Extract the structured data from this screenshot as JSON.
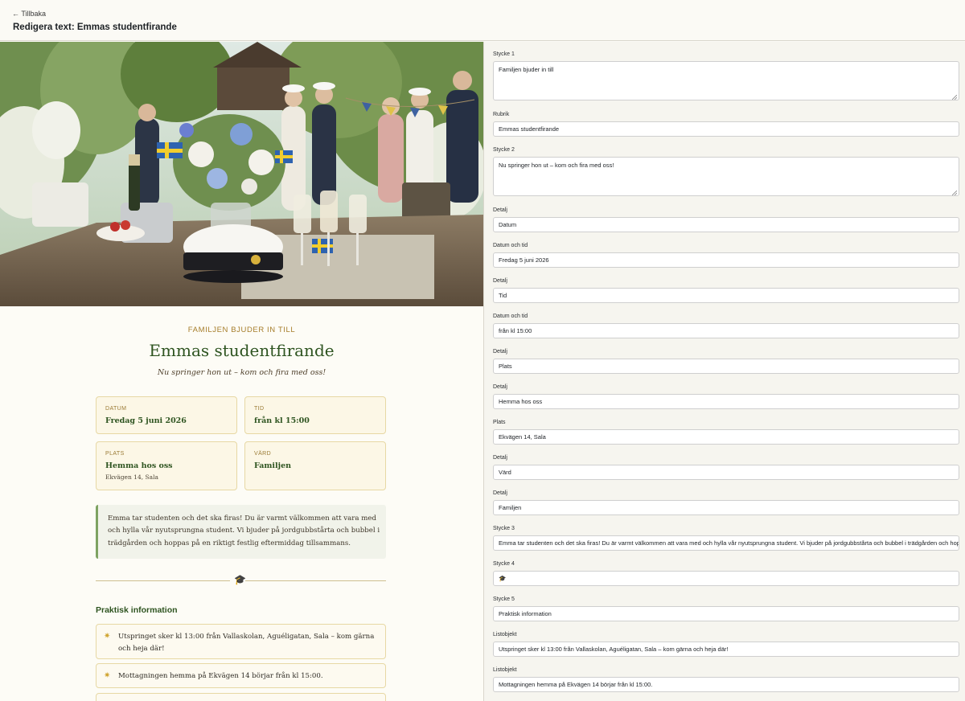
{
  "header": {
    "back_label": "← Tillbaka",
    "title": "Redigera text: Emmas studentfirande"
  },
  "invite": {
    "eyebrow": "FAMILJEN BJUDER IN TILL",
    "title": "Emmas studentfirande",
    "subtitle": "Nu springer hon ut – kom och fira med oss!",
    "details": [
      {
        "label": "DATUM",
        "value": "Fredag 5 juni 2026",
        "extra": ""
      },
      {
        "label": "TID",
        "value": "från kl 15:00",
        "extra": ""
      },
      {
        "label": "PLATS",
        "value": "Hemma hos oss",
        "extra": "Ekvägen 14, Sala"
      },
      {
        "label": "VÄRD",
        "value": "Familjen",
        "extra": ""
      }
    ],
    "paragraph": "Emma tar studenten och det ska firas! Du är varmt välkommen att vara med och hylla vår nyutsprungna student. Vi bjuder på jordgubbstårta och bubbel i trädgården och hoppas på en riktigt festlig eftermiddag tillsammans.",
    "divider_icon": "🎓",
    "practical_title": "Praktisk information",
    "practical_items": [
      "Utspringet sker kl 13:00 från Vallaskolan, Aguéligatan, Sala – kom gärna och heja där!",
      "Mottagningen hemma på Ekvägen 14 börjar från kl 15:00."
    ],
    "list_icon_name": "star-icon",
    "accent_green": "#2e5420",
    "accent_gold": "#a67d2a"
  },
  "editor": {
    "fields": [
      {
        "label": "Stycke 1",
        "value": "Familjen bjuder in till",
        "multiline": true
      },
      {
        "label": "Rubrik",
        "value": "Emmas studentfirande",
        "multiline": false
      },
      {
        "label": "Stycke 2",
        "value": "Nu springer hon ut – kom och fira med oss!",
        "multiline": true
      },
      {
        "label": "Detalj",
        "value": "Datum",
        "multiline": false
      },
      {
        "label": "Datum och tid",
        "value": "Fredag 5 juni 2026",
        "multiline": false
      },
      {
        "label": "Detalj",
        "value": "Tid",
        "multiline": false
      },
      {
        "label": "Datum och tid",
        "value": "från kl 15:00",
        "multiline": false
      },
      {
        "label": "Detalj",
        "value": "Plats",
        "multiline": false
      },
      {
        "label": "Detalj",
        "value": "Hemma hos oss",
        "multiline": false
      },
      {
        "label": "Plats",
        "value": "Ekvägen 14, Sala",
        "multiline": false
      },
      {
        "label": "Detalj",
        "value": "Värd",
        "multiline": false
      },
      {
        "label": "Detalj",
        "value": "Familjen",
        "multiline": false
      },
      {
        "label": "Stycke 3",
        "value": "Emma tar studenten och det ska firas! Du är varmt välkommen att vara med och hylla vår nyutsprungna student. Vi bjuder på jordgubbstårta och bubbel i trädgården och hoppas på en riktigt festlig eftermiddag tillsammans.",
        "multiline": false
      },
      {
        "label": "Stycke 4",
        "value": "🎓",
        "multiline": false
      },
      {
        "label": "Stycke 5",
        "value": "Praktisk information",
        "multiline": false
      },
      {
        "label": "Listobjekt",
        "value": "Utspringet sker kl 13:00 från Vallaskolan, Aguéligatan, Sala – kom gärna och heja där!",
        "multiline": false
      },
      {
        "label": "Listobjekt",
        "value": "Mottagningen hemma på Ekvägen 14 börjar från kl 15:00.",
        "multiline": false
      }
    ]
  }
}
